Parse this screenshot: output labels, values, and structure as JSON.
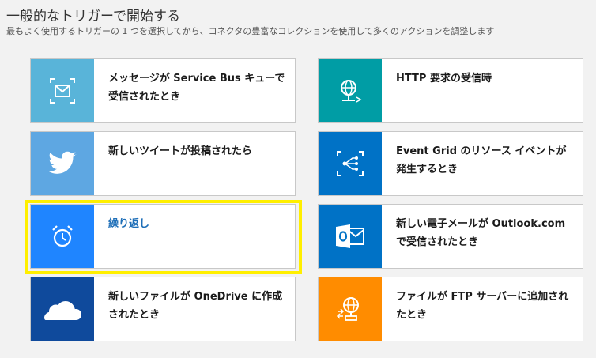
{
  "header": {
    "title": "一般的なトリガーで開始する",
    "subtitle": "最もよく使用するトリガーの 1 つを選択してから、コネクタの豊富なコレクションを使用して多くのアクションを調整します"
  },
  "cards": [
    {
      "label": "メッセージが Service Bus キューで受信されたとき",
      "icon": "envelope-icon",
      "color": "#59b4d9"
    },
    {
      "label": "HTTP 要求の受信時",
      "icon": "globe-network-icon",
      "color": "#009da5"
    },
    {
      "label": "新しいツイートが投稿されたら",
      "icon": "twitter-bird-icon",
      "color": "#5ea7e2"
    },
    {
      "label": "Event Grid のリソース イベントが発生するとき",
      "icon": "event-grid-icon",
      "color": "#0072c6"
    },
    {
      "label": "繰り返し",
      "icon": "alarm-clock-icon",
      "color": "#1f85ff",
      "selected": true
    },
    {
      "label": "新しい電子メールが Outlook.com で受信されたとき",
      "icon": "outlook-icon",
      "color": "#0072c6"
    },
    {
      "label": "新しいファイルが OneDrive に作成されたとき",
      "icon": "cloud-icon",
      "color": "#0f4a9c"
    },
    {
      "label": "ファイルが FTP サーバーに追加されたとき",
      "icon": "ftp-globe-icon",
      "color": "#ff8c00"
    }
  ],
  "highlight_color": "#ffef00"
}
